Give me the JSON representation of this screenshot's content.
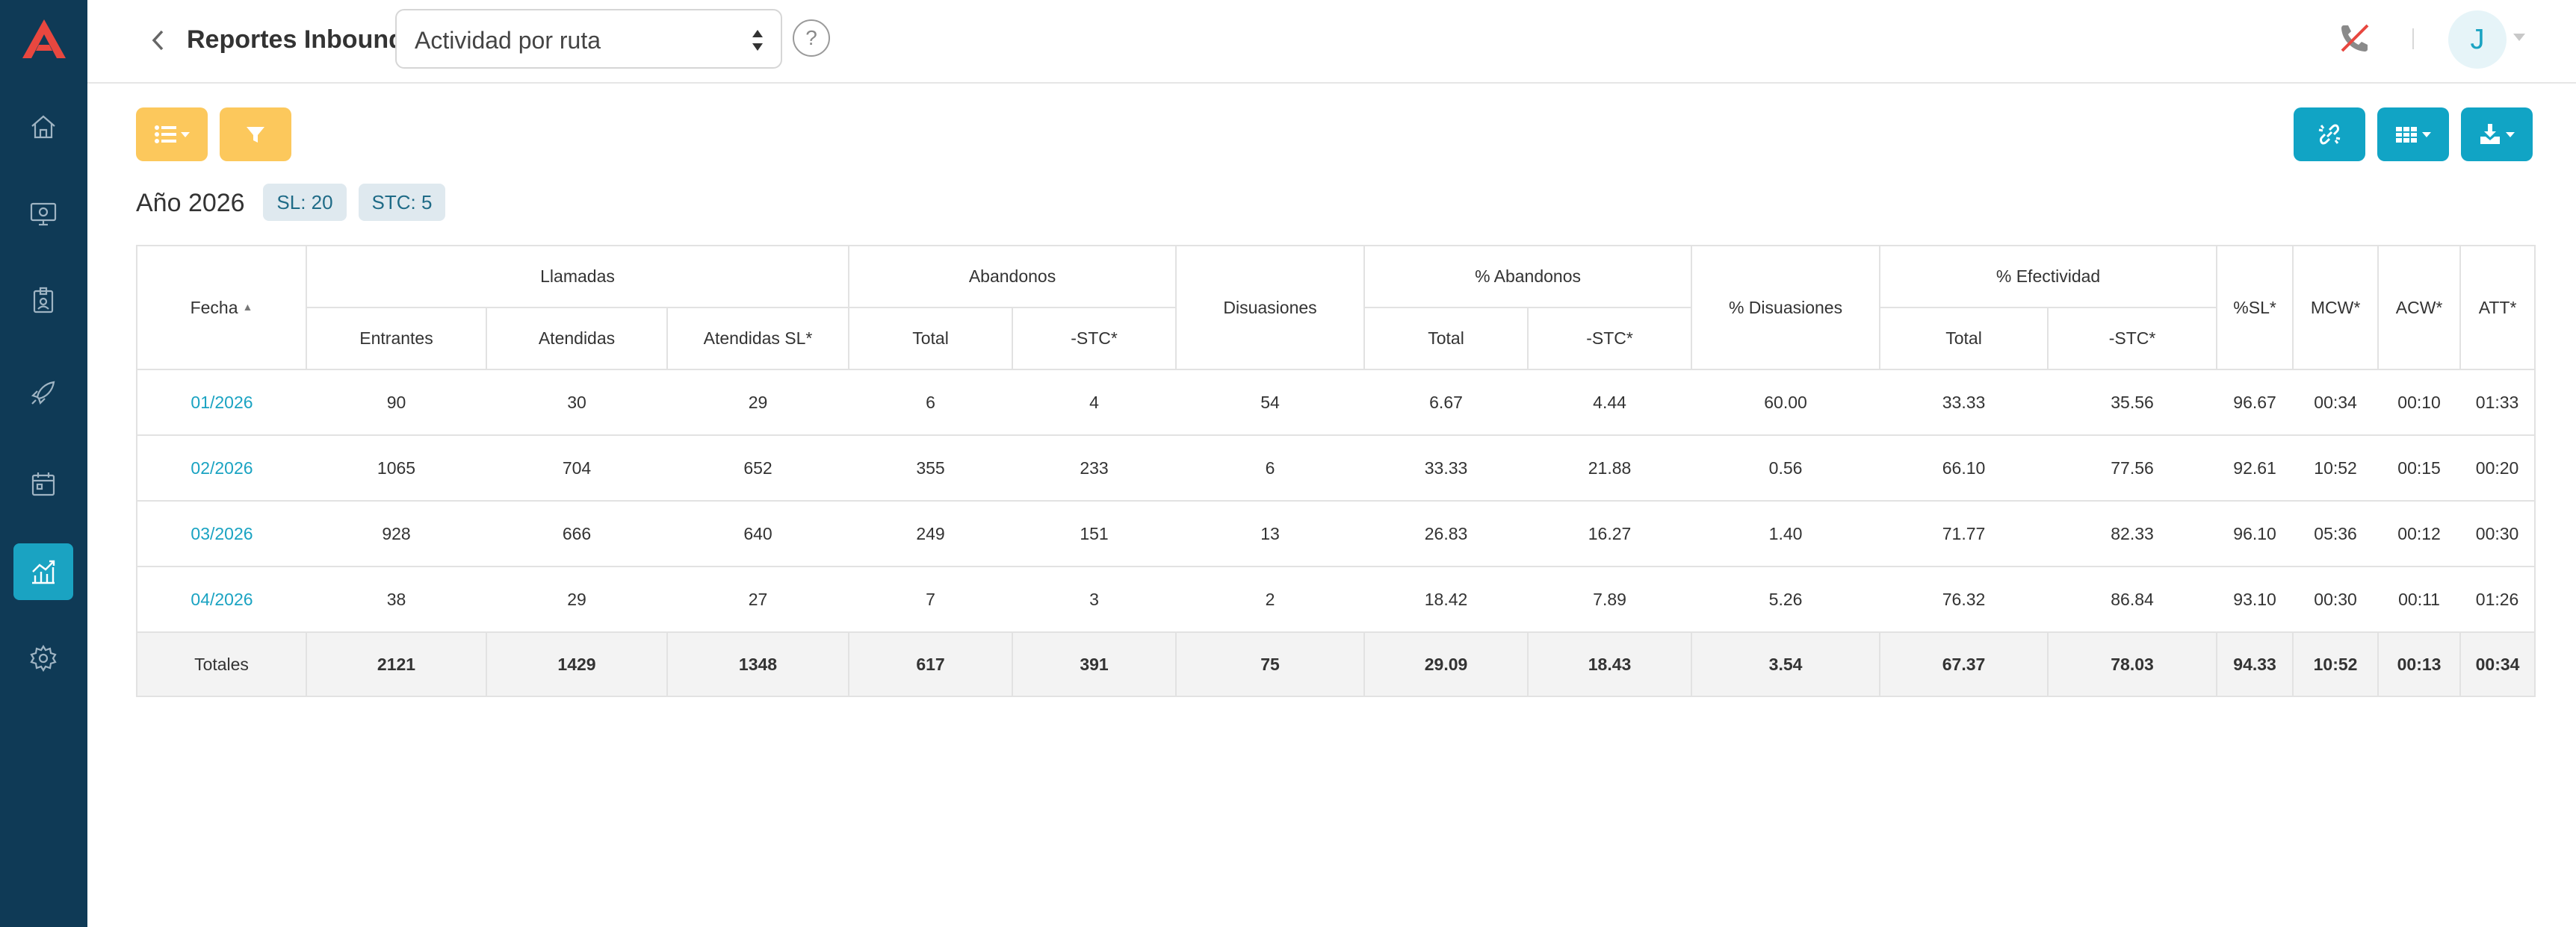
{
  "header": {
    "title": "Reportes Inbound:",
    "report_selected": "Actividad por ruta",
    "help": "?",
    "avatar_initial": "J"
  },
  "sidebar": {
    "items": [
      {
        "icon": "home-icon"
      },
      {
        "icon": "monitor-icon"
      },
      {
        "icon": "badge-icon"
      },
      {
        "icon": "rocket-icon"
      },
      {
        "icon": "calendar-icon"
      },
      {
        "icon": "reports-chart-icon",
        "active": true
      },
      {
        "icon": "settings-icon"
      }
    ]
  },
  "summary": {
    "year_title": "Año 2026",
    "badges": [
      "SL: 20",
      "STC: 5"
    ]
  },
  "table": {
    "group_headers": {
      "fecha": "Fecha",
      "llamadas": "Llamadas",
      "abandonos": "Abandonos",
      "disuasiones": "Disuasiones",
      "pct_abandonos": "% Abandonos",
      "pct_disuasiones": "% Disuasiones",
      "pct_efectividad": "% Efectividad",
      "sl": "%SL*",
      "mcw": "MCW*",
      "acw": "ACW*",
      "att": "ATT*"
    },
    "sub_headers": {
      "entrantes": "Entrantes",
      "atendidas": "Atendidas",
      "atendidas_sl": "Atendidas SL*",
      "ab_total": "Total",
      "ab_stc": "-STC*",
      "pab_total": "Total",
      "pab_stc": "-STC*",
      "pef_total": "Total",
      "pef_stc": "-STC*"
    },
    "rows": [
      {
        "fecha": "01/2026",
        "entrantes": "90",
        "atendidas": "30",
        "atendidas_sl": "29",
        "ab_total": "6",
        "ab_stc": "4",
        "disuasiones": "54",
        "pab_total": "6.67",
        "pab_stc": "4.44",
        "pdis": "60.00",
        "pef_total": "33.33",
        "pef_stc": "35.56",
        "sl": "96.67",
        "mcw": "00:34",
        "acw": "00:10",
        "att": "01:33"
      },
      {
        "fecha": "02/2026",
        "entrantes": "1065",
        "atendidas": "704",
        "atendidas_sl": "652",
        "ab_total": "355",
        "ab_stc": "233",
        "disuasiones": "6",
        "pab_total": "33.33",
        "pab_stc": "21.88",
        "pdis": "0.56",
        "pef_total": "66.10",
        "pef_stc": "77.56",
        "sl": "92.61",
        "mcw": "10:52",
        "acw": "00:15",
        "att": "00:20"
      },
      {
        "fecha": "03/2026",
        "entrantes": "928",
        "atendidas": "666",
        "atendidas_sl": "640",
        "ab_total": "249",
        "ab_stc": "151",
        "disuasiones": "13",
        "pab_total": "26.83",
        "pab_stc": "16.27",
        "pdis": "1.40",
        "pef_total": "71.77",
        "pef_stc": "82.33",
        "sl": "96.10",
        "mcw": "05:36",
        "acw": "00:12",
        "att": "00:30"
      },
      {
        "fecha": "04/2026",
        "entrantes": "38",
        "atendidas": "29",
        "atendidas_sl": "27",
        "ab_total": "7",
        "ab_stc": "3",
        "disuasiones": "2",
        "pab_total": "18.42",
        "pab_stc": "7.89",
        "pdis": "5.26",
        "pef_total": "76.32",
        "pef_stc": "86.84",
        "sl": "93.10",
        "mcw": "00:30",
        "acw": "00:11",
        "att": "01:26"
      }
    ],
    "totals": {
      "label": "Totales",
      "entrantes": "2121",
      "atendidas": "1429",
      "atendidas_sl": "1348",
      "ab_total": "617",
      "ab_stc": "391",
      "disuasiones": "75",
      "pab_total": "29.09",
      "pab_stc": "18.43",
      "pdis": "3.54",
      "pef_total": "67.37",
      "pef_stc": "78.03",
      "sl": "94.33",
      "mcw": "10:52",
      "acw": "00:13",
      "att": "00:34"
    }
  },
  "colors": {
    "sidebar": "#0f3a56",
    "accent": "#1aa3c2",
    "yellow_button": "#fcc85c",
    "teal_button": "#11a4c5",
    "logo": "#e8473f"
  }
}
